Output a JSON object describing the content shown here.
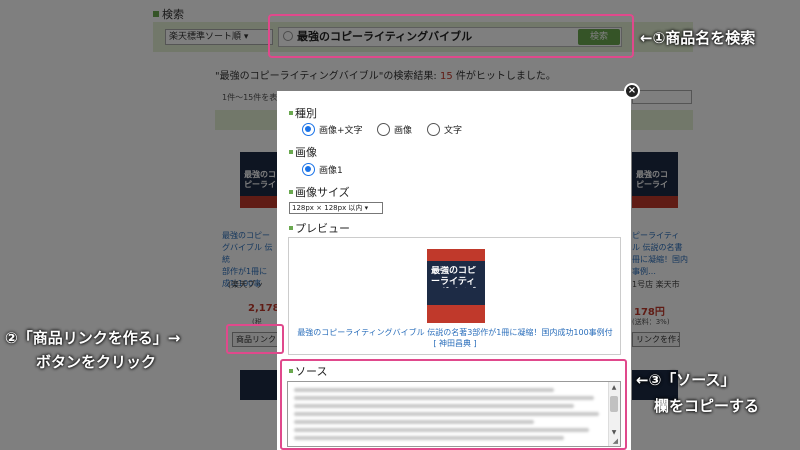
{
  "page": {
    "section_title": "検索",
    "sort_select": "楽天標準ソート順",
    "search_value": "最強のコピーライティングバイブル",
    "search_button": "検索",
    "result_prefix": "\"最強のコピーライティングバイブル\"の検索結果: ",
    "result_count": "15",
    "result_suffix": " 件がヒットしました。",
    "paging_text": "1件〜15件を表",
    "cards": [
      {
        "book_title": "最強のコピーライティングバイブル",
        "desc": "最強のコピー\nグバイブル 伝統\n部作が1冊に\n成功100事",
        "shop": "(楽天ブッ",
        "price": "2,178",
        "sub": "(税",
        "link_button": "商品リンク"
      },
      {
        "book_title": "最強のコピーライティングバイブル",
        "desc": "ピーライティ\nル 伝説の名書\n冊に凝縮！国内\n事例…",
        "shop": "1号店 楽天市",
        "price": "178円",
        "sub": "(送料：3%)",
        "link_button": "リンクを作る"
      }
    ]
  },
  "modal": {
    "close_label": "×",
    "type_heading": "種別",
    "type_options": [
      "画像+文字",
      "画像",
      "文字"
    ],
    "image_heading": "画像",
    "image_options": [
      "画像1"
    ],
    "size_heading": "画像サイズ",
    "size_value": "128px × 128px 以内",
    "preview_heading": "プレビュー",
    "preview_book_title": "最強のコピーライティングバイブル",
    "preview_link": "最強のコピーライティングバイブル 伝説の名著3部作が1冊に凝縮！国内成功100事例付 [ 神田昌典 ]",
    "source_heading": "ソース"
  },
  "annotations": {
    "step1": "←①商品名を検索",
    "step2_line1": "②「商品リンクを作る」→",
    "step2_line2": "ボタンをクリック",
    "step3_line1": "←③「ソース」",
    "step3_line2": "欄をコピーする"
  },
  "colors": {
    "highlight": "#e0498c",
    "accent_green": "#6aa84f",
    "radio_blue": "#1a73e8",
    "price_red": "#c0392b"
  }
}
